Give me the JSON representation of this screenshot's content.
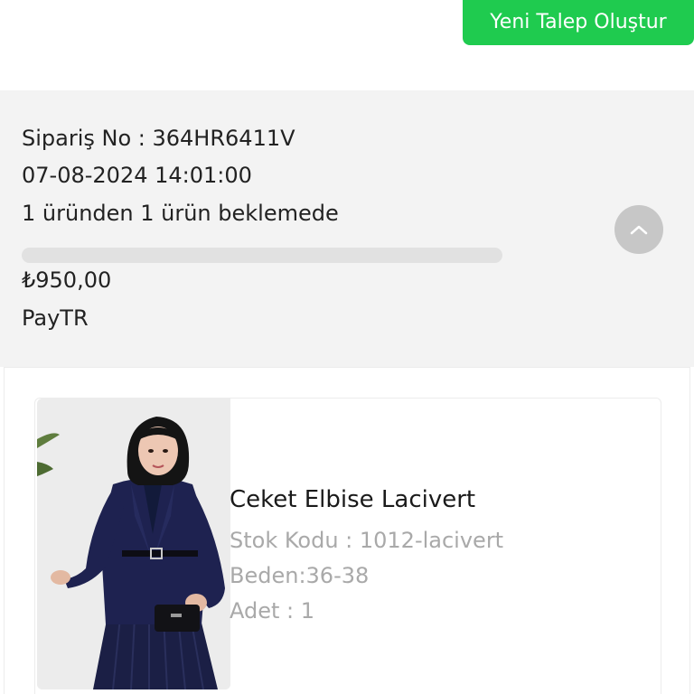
{
  "header": {
    "new_request_label": "Yeni Talep Oluştur"
  },
  "order": {
    "order_no": "Sipariş No : 364HR6411V",
    "date": "07-08-2024 14:01:00",
    "status": "1 üründen 1 ürün beklemede",
    "progress": 0,
    "total": "₺950,00",
    "payment_method": "PayTR",
    "collapse_icon": "chevron-up-icon"
  },
  "products": [
    {
      "name": "Ceket Elbise Lacivert",
      "stock_code": "Stok Kodu : 1012-lacivert",
      "size": "Beden:36-38",
      "quantity": "Adet : 1"
    }
  ],
  "colors": {
    "accent": "#1fcb4f",
    "panel_bg": "#f3f3f3",
    "muted_text": "#a9a9a9"
  }
}
